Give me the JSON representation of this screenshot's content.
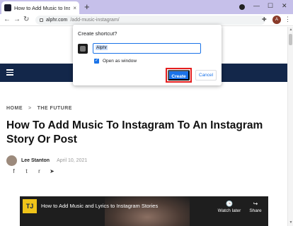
{
  "browser": {
    "tab_title": "How to Add Music to Instagram S",
    "tab_close": "×",
    "new_tab": "+",
    "url_host": "alphr.com",
    "url_path": "/add-music-instagram/",
    "avatar_initial": "A",
    "window_controls": {
      "minimize": "—",
      "maximize": "☐",
      "close": "✕"
    },
    "nav": {
      "back": "←",
      "forward": "→",
      "reload": "↻"
    },
    "extensions_icon": "puzzle-icon",
    "menu_icon": "⋮"
  },
  "dialog": {
    "title": "Create shortcut?",
    "name_value": "Alphr",
    "checkbox_label": "Open as window",
    "checkbox_checked": true,
    "create_label": "Create",
    "cancel_label": "Cancel"
  },
  "article": {
    "breadcrumb": [
      "HOME",
      "THE FUTURE"
    ],
    "breadcrumb_sep": ">",
    "title": "How To Add Music To Instagram To An Instagram Story Or Post",
    "author": "Lee Stanton",
    "date": "April 10, 2021",
    "share_icons": [
      "facebook-icon",
      "twitter-icon",
      "reddit-icon",
      "telegram-icon"
    ],
    "share_glyphs": [
      "f",
      "t",
      "r",
      "➤"
    ]
  },
  "video": {
    "logo": "TJ",
    "title": "How to Add Music and Lyrics to Instagram Stories",
    "watch_later_icon": "🕒",
    "watch_later": "Watch later",
    "share_icon": "↪",
    "share": "Share"
  },
  "colors": {
    "tabbar": "#c6c0ea",
    "site_nav": "#13274a",
    "accent": "#1a73e8",
    "highlight": "#e41e1e"
  }
}
